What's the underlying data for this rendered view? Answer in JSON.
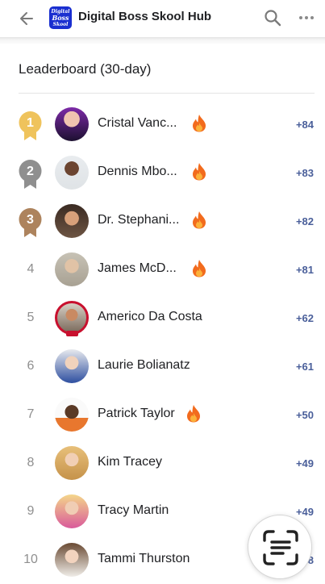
{
  "header": {
    "app_title": "Digital Boss Skool Hub",
    "logo_lines": [
      "Digital",
      "Boss",
      "Skool"
    ],
    "back_icon": "arrow-left-icon",
    "search_icon": "search-icon",
    "more_icon": "more-horizontal-icon"
  },
  "leaderboard": {
    "title": "Leaderboard (30-day)",
    "rows": [
      {
        "rank": "1",
        "name": "Cristal Vanc...",
        "points": "+84",
        "fire": true,
        "medal": "gold"
      },
      {
        "rank": "2",
        "name": "Dennis Mbo...",
        "points": "+83",
        "fire": true,
        "medal": "silver"
      },
      {
        "rank": "3",
        "name": "Dr. Stephani...",
        "points": "+82",
        "fire": true,
        "medal": "bronze"
      },
      {
        "rank": "4",
        "name": "James McD...",
        "points": "+81",
        "fire": true
      },
      {
        "rank": "5",
        "name": "Americo Da Costa",
        "points": "+62",
        "fire": false,
        "live": true
      },
      {
        "rank": "6",
        "name": "Laurie Bolianatz",
        "points": "+61",
        "fire": false
      },
      {
        "rank": "7",
        "name": "Patrick Taylor",
        "points": "+50",
        "fire": true
      },
      {
        "rank": "8",
        "name": "Kim Tracey",
        "points": "+49",
        "fire": false
      },
      {
        "rank": "9",
        "name": "Tracy Martin",
        "points": "+49",
        "fire": false
      },
      {
        "rank": "10",
        "name": "Tammi Thurston",
        "points": "+48",
        "fire": false
      }
    ]
  },
  "fab": {
    "icon": "scan-text-icon"
  },
  "colors": {
    "gold": "#efc35c",
    "silver": "#8f8f8f",
    "bronze": "#ad835d",
    "points": "#4a5f9a",
    "logo_bg": "#1a2fd0"
  }
}
